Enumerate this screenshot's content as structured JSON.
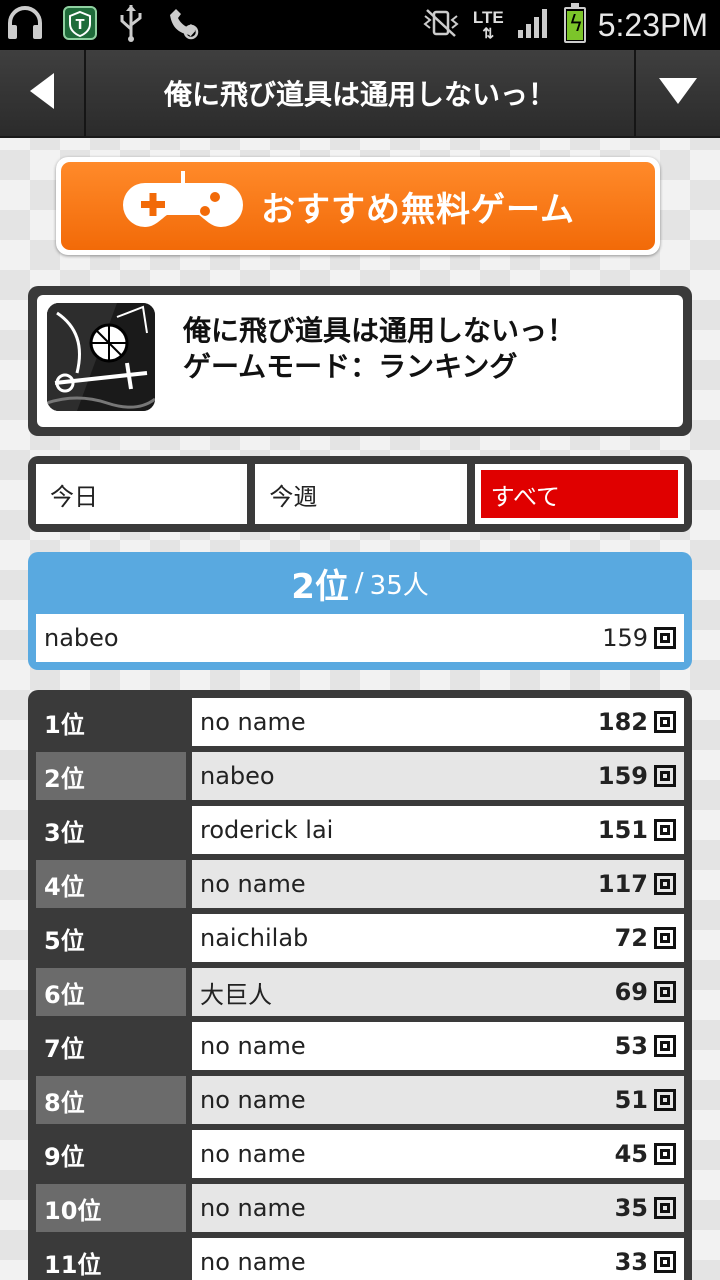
{
  "status_bar": {
    "time": "5:23PM",
    "network": "LTE",
    "left_icons": [
      "headphones-icon",
      "shield-t-icon",
      "usb-icon",
      "missed-call-icon"
    ],
    "right_icons": [
      "mute-vibrate-icon",
      "signal-icon",
      "battery-charging-icon"
    ]
  },
  "header": {
    "title": "俺に飛び道具は通用しないっ！",
    "back_icon": "back-arrow-icon",
    "menu_icon": "dropdown-arrow-icon"
  },
  "banner": {
    "label": "おすすめ無料ゲーム",
    "icon": "gamepad-icon"
  },
  "game": {
    "title": "俺に飛び道具は通用しないっ！",
    "mode": "ゲームモード：ランキング"
  },
  "tabs": [
    {
      "label": "今日",
      "active": false
    },
    {
      "label": "今週",
      "active": false
    },
    {
      "label": "すべて",
      "active": true
    }
  ],
  "my_rank": {
    "position": "2位",
    "separator": "/",
    "total": "35人",
    "name": "nabeo",
    "score": "159"
  },
  "ranking": [
    {
      "rank": "1位",
      "name": "no name",
      "score": "182"
    },
    {
      "rank": "2位",
      "name": "nabeo",
      "score": "159"
    },
    {
      "rank": "3位",
      "name": "roderick lai",
      "score": "151"
    },
    {
      "rank": "4位",
      "name": "no name",
      "score": "117"
    },
    {
      "rank": "5位",
      "name": "naichilab",
      "score": "72"
    },
    {
      "rank": "6位",
      "name": "大巨人",
      "score": "69"
    },
    {
      "rank": "7位",
      "name": "no name",
      "score": "53"
    },
    {
      "rank": "8位",
      "name": "no name",
      "score": "51"
    },
    {
      "rank": "9位",
      "name": "no name",
      "score": "45"
    },
    {
      "rank": "10位",
      "name": "no name",
      "score": "35"
    },
    {
      "rank": "11位",
      "name": "no name",
      "score": "33"
    }
  ],
  "colors": {
    "accent_orange": "#f26a08",
    "tab_active": "#e00000",
    "my_rank_blue": "#59a9e0",
    "panel_dark": "#3a3a3a"
  }
}
